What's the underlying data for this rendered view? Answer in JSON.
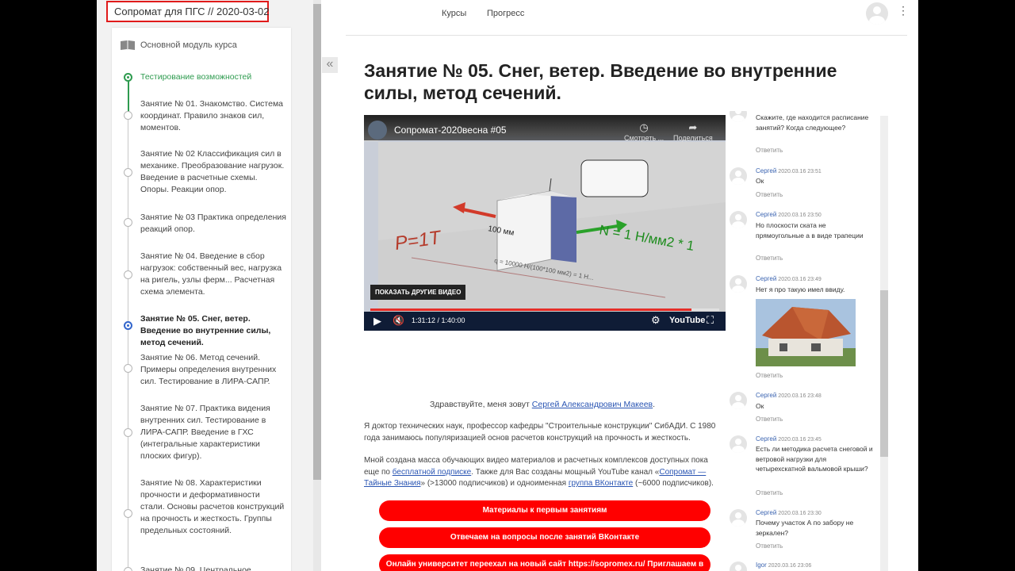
{
  "course": {
    "title": "Сопромат для ПГС // 2020-03-02"
  },
  "toc": {
    "header": "Основной модуль курса",
    "items": [
      {
        "label": "Тестирование возможностей",
        "state": "done"
      },
      {
        "label": "Занятие № 01. Знакомство. Система координат. Правило знаков сил, моментов.",
        "state": ""
      },
      {
        "label": "Занятие № 02 Классификация сил в механике. Преобразование нагрузок. Введение в расчетные схемы. Опоры. Реакции опор.",
        "state": ""
      },
      {
        "label": "Занятие № 03 Практика определения реакций опор.",
        "state": ""
      },
      {
        "label": "Занятие № 04. Введение в сбор нагрузок: собственный вес, нагрузка на ригель, узлы ферм... Расчетная схема элемента.",
        "state": ""
      },
      {
        "label": "Занятие № 05. Снег, ветер. Введение во внутренние силы, метод сечений.",
        "state": "current"
      },
      {
        "label": "Занятие № 06. Метод сечений. Примеры определения внутренних сил. Тестирование в ЛИРА-САПР.",
        "state": ""
      },
      {
        "label": "Занятие № 07. Практика видения внутренних сил. Тестирование в ЛИРА-САПР. Введение в ГХС (интегральные характеристики плоских фигур).",
        "state": ""
      },
      {
        "label": "Занятие № 08. Характеристики прочности и деформативности стали. Основы расчетов конструкций на прочность и жесткость. Группы предельных состояний.",
        "state": ""
      },
      {
        "label": "Занятие № 09. Центральное",
        "state": ""
      }
    ]
  },
  "nav": {
    "courses": "Курсы",
    "progress": "Прогресс"
  },
  "lesson": {
    "title": "Занятие № 05. Снег, ветер. Введение во внутренние силы, метод сечений."
  },
  "video": {
    "title": "Сопромат-2020весна #05",
    "watch_later": "Смотреть ...",
    "share": "Поделиться",
    "more_videos": "ПОКАЗАТЬ ДРУГИЕ ВИДЕО",
    "time": "1:31:12 / 1:40:00",
    "brand": "YouTube",
    "progress": 0.92,
    "scene": {
      "force_label": "P=1T",
      "dim_label": "100 мм",
      "stress_label": "N = 1 Н/мм2 * 1",
      "formula": "q = 10000 Н/(100*100 мм2) = 1 Н..."
    }
  },
  "content": {
    "greeting_prefix": "Здравствуйте, меня зовут ",
    "greeting_link": "Сергей Александрович Макеев",
    "greeting_suffix": ".",
    "p1": "Я доктор технических наук, профессор кафедры \"Строительные конструкции\" СибАДИ. С 1980 года занимаюсь популяризацией основ расчетов конструкций на прочность и жесткость.",
    "p2_a": "Мной создана масса обучающих видео материалов и расчетных комплексов доступных пока еще по ",
    "p2_link1": "бесплатной подписке",
    "p2_b": ". Также для Вас созданы мощный YouTube канал «",
    "p2_link2": "Сопромат — Тайные Знания",
    "p2_c": "» (>13000 подписчиков) и одноименная ",
    "p2_link3": "группа ВКонтакте",
    "p2_d": " (~6000 подписчиков).",
    "buttons": [
      "Материалы к первым занятиям",
      "Отвечаем на вопросы после занятий ВКонтакте",
      "Онлайн университет переехал на новый сайт https://sopromex.ru/  Приглашаем в"
    ]
  },
  "comments": [
    {
      "author": "",
      "date": "",
      "text": "Скажите, где находится расписание занятий? Когда следующее?",
      "reply": "Ответить"
    },
    {
      "author": "Сергей",
      "date": "2020.03.16 23:51",
      "text": "Ок",
      "reply": "Ответить"
    },
    {
      "author": "Сергей",
      "date": "2020.03.16 23:50",
      "text": "Но плоскости ската не прямоугольные а в виде трапеции",
      "reply": "Ответить"
    },
    {
      "author": "Сергей",
      "date": "2020.03.16 23:49",
      "text": "Нет я про такую имел ввиду.",
      "reply": "Ответить"
    },
    {
      "author": "Сергей",
      "date": "2020.03.16 23:48",
      "text": "Ок",
      "reply": "Ответить"
    },
    {
      "author": "Сергей",
      "date": "2020.03.16 23:45",
      "text": "Есть ли методика расчета снеговой и ветровой нагрузки для четырехскатной вальмовой крыши?",
      "reply": "Ответить"
    },
    {
      "author": "Сергей",
      "date": "2020.03.16 23:30",
      "text": "Почему участок А по забору не зеркален?",
      "reply": "Ответить"
    },
    {
      "author": "Igor",
      "date": "2020.03.16 23:06",
      "text": "",
      "reply": ""
    }
  ],
  "colors": {
    "accent_red": "#ff0000",
    "done_green": "#2e9b4f",
    "current_blue": "#3366cc",
    "link_blue": "#2a55b3",
    "highlight_border": "#e01b1b"
  }
}
